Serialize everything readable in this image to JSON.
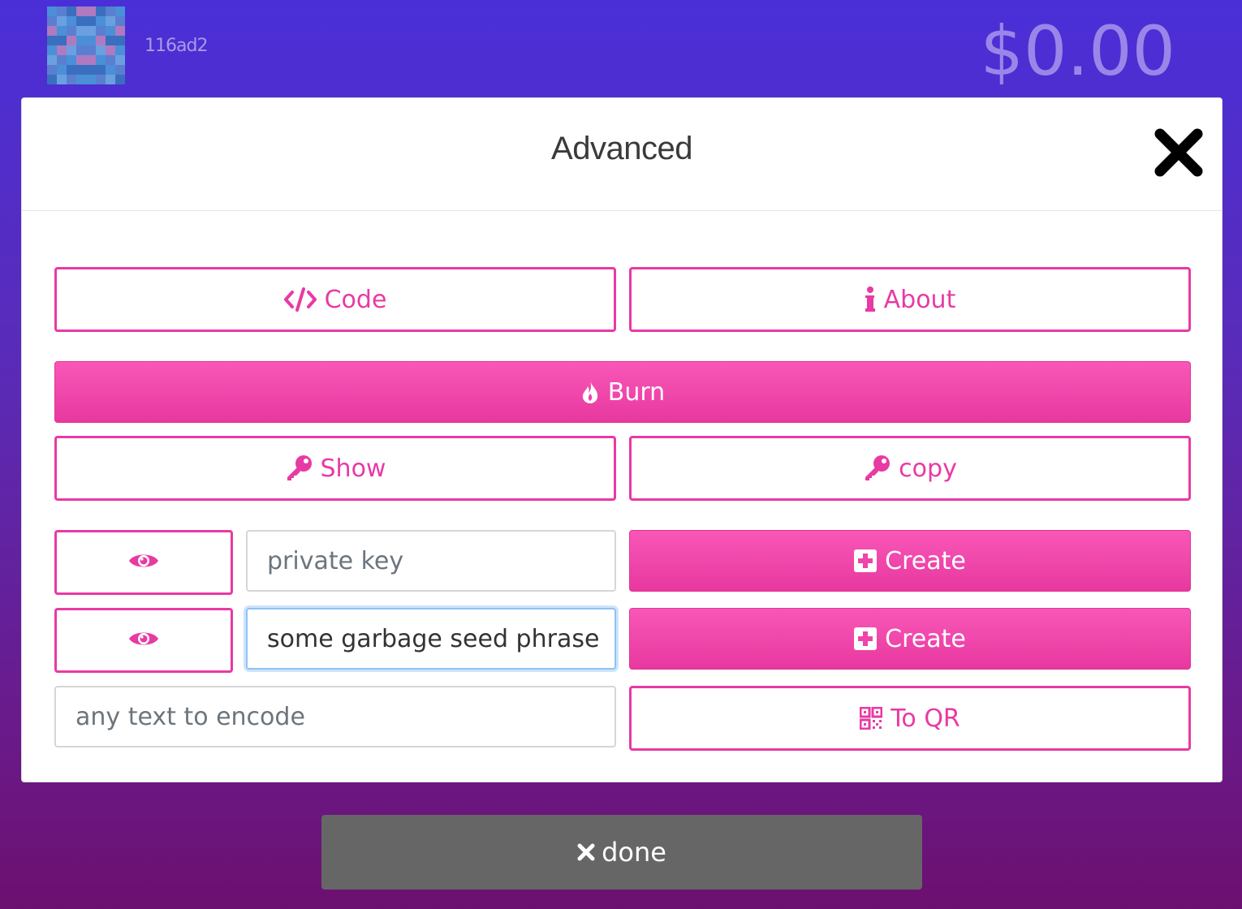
{
  "header": {
    "address": "116ad2",
    "balance": "$0.00"
  },
  "modal": {
    "title": "Advanced",
    "buttons": {
      "code": "Code",
      "about": "About",
      "burn": "Burn",
      "show": "Show",
      "copy": "copy",
      "create_private_key": "Create",
      "create_seed": "Create",
      "to_qr": "To QR"
    },
    "inputs": {
      "private_key": {
        "value": "",
        "placeholder": "private key"
      },
      "seed_phrase": {
        "value": "some garbage seed phrase",
        "placeholder": ""
      },
      "encode_text": {
        "value": "",
        "placeholder": "any text to encode"
      }
    },
    "icons": {
      "code": "code-icon",
      "about": "info-icon",
      "burn": "fire-icon",
      "show": "key-icon",
      "copy": "key-icon",
      "reveal": "eye-icon",
      "create": "plus-square-icon",
      "qr": "qrcode-icon",
      "close": "close-icon"
    }
  },
  "footer": {
    "done": "done"
  },
  "colors": {
    "accent": "#e83aa4",
    "background_top": "#4a2fd8",
    "background_bottom": "#6c1070",
    "done_button": "#666666"
  }
}
